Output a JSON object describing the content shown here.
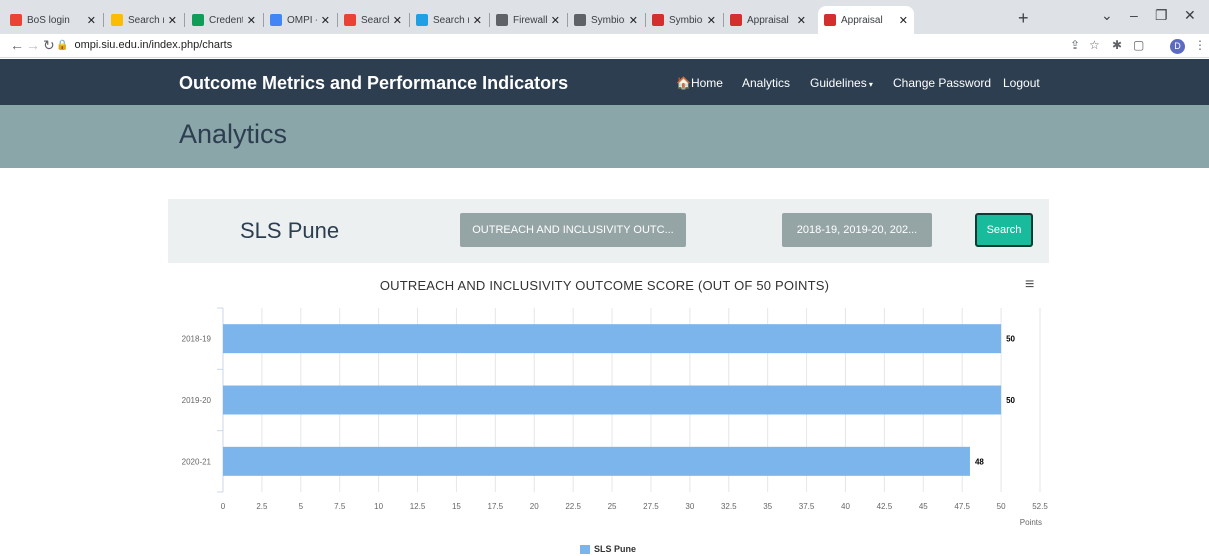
{
  "browser": {
    "tabs": [
      {
        "label": "BoS login",
        "fav": "gmail-icon",
        "color": "#ea4335"
      },
      {
        "label": "Search res",
        "fav": "drive-icon",
        "color": "#fbbc04"
      },
      {
        "label": "Credential",
        "fav": "sheets-icon",
        "color": "#0f9d58"
      },
      {
        "label": "OMPI -Scr",
        "fav": "docs-icon",
        "color": "#4285f4"
      },
      {
        "label": "Search res",
        "fav": "gmail-icon",
        "color": "#ea4335"
      },
      {
        "label": "Search res",
        "fav": "edge-icon",
        "color": "#1fa0e5"
      },
      {
        "label": "Firewall Au",
        "fav": "globe-icon",
        "color": "#5f6368"
      },
      {
        "label": "Symbiosis",
        "fav": "globe-icon",
        "color": "#5f6368"
      },
      {
        "label": "Symbiosis",
        "fav": "siu-icon",
        "color": "#d32f2f"
      },
      {
        "label": "Appraisal",
        "fav": "siu-icon",
        "color": "#d32f2f"
      },
      {
        "label": "Appraisal",
        "fav": "siu-icon",
        "color": "#d32f2f"
      }
    ],
    "url": "ompi.siu.edu.in/index.php/charts",
    "avatar": "D"
  },
  "nav": {
    "brand": "Outcome Metrics and Performance Indicators",
    "home": "Home",
    "analytics": "Analytics",
    "guidelines": "Guidelines",
    "change_password": "Change Password",
    "logout": "Logout"
  },
  "page": {
    "title": "Analytics"
  },
  "filters": {
    "org": "SLS Pune",
    "category": "OUTREACH AND INCLUSIVITY OUTC...",
    "years": "2018-19, 2019-20, 202...",
    "search": "Search"
  },
  "chart_data": {
    "type": "bar",
    "orientation": "horizontal",
    "title": "OUTREACH AND INCLUSIVITY OUTCOME SCORE (OUT OF 50 POINTS)",
    "categories": [
      "2018-19",
      "2019-20",
      "2020-21"
    ],
    "series": [
      {
        "name": "SLS Pune",
        "values": [
          50,
          50,
          48
        ],
        "color": "#7cb5ec"
      }
    ],
    "xlabel": "Points",
    "xlim": [
      0,
      52.5
    ],
    "xticks": [
      "0",
      "2.5",
      "5",
      "7.5",
      "10",
      "12.5",
      "15",
      "17.5",
      "20",
      "22.5",
      "25",
      "27.5",
      "30",
      "32.5",
      "35",
      "37.5",
      "40",
      "42.5",
      "45",
      "47.5",
      "50",
      "52.5"
    ],
    "grid": true,
    "legend": "bottom-center"
  }
}
